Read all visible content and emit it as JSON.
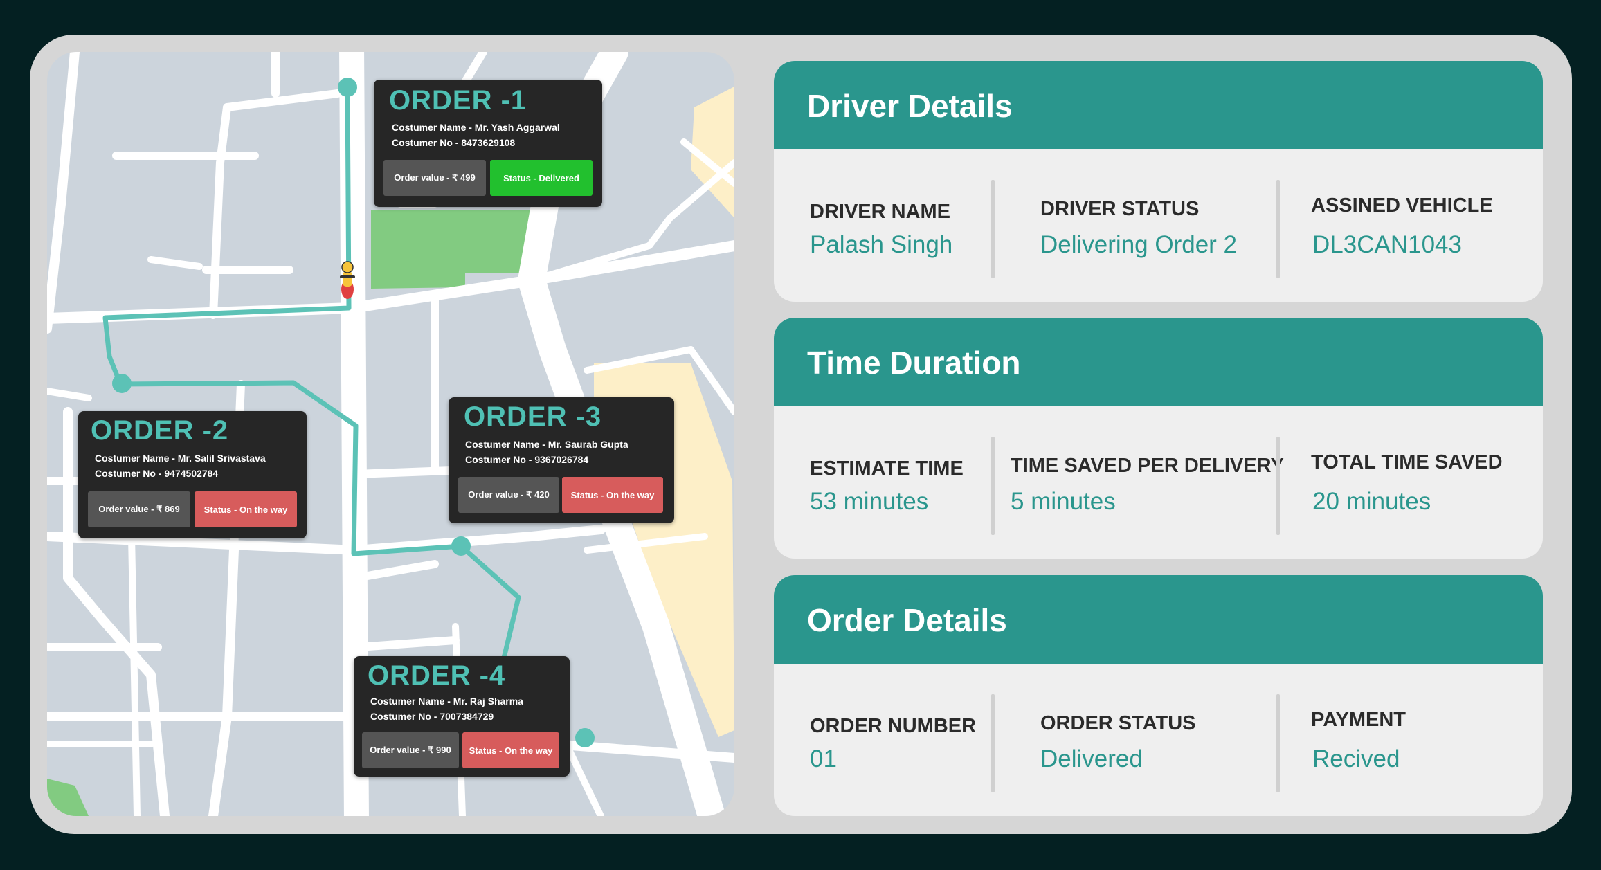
{
  "map": {
    "rider_icon": "delivery-scooter-icon",
    "orders": [
      {
        "title": "ORDER -1",
        "customer_name": "Costumer Name - Mr. Yash Aggarwal",
        "customer_no": "Costumer No - 8473629108",
        "order_value": "Order value - ₹ 499",
        "status": "Status - Delivered",
        "status_color": "#22c02e"
      },
      {
        "title": "ORDER -2",
        "customer_name": "Costumer Name - Mr. Salil Srivastava",
        "customer_no": "Costumer No - 9474502784",
        "order_value": "Order value - ₹ 869",
        "status": "Status - On the way",
        "status_color": "#d75c5c"
      },
      {
        "title": "ORDER -3",
        "customer_name": "Costumer Name - Mr. Saurab Gupta",
        "customer_no": "Costumer No - 9367026784",
        "order_value": "Order value - ₹ 420",
        "status": "Status - On the way",
        "status_color": "#d75c5c"
      },
      {
        "title": "ORDER -4",
        "customer_name": "Costumer Name - Mr. Raj Sharma",
        "customer_no": "Costumer No - 7007384729",
        "order_value": "Order value - ₹ 990",
        "status": "Status - On the way",
        "status_color": "#d75c5c"
      }
    ]
  },
  "driver_details": {
    "title": "Driver Details",
    "fields": [
      {
        "label": "DRIVER NAME",
        "value": "Palash Singh"
      },
      {
        "label": "DRIVER STATUS",
        "value": "Delivering Order 2"
      },
      {
        "label": "ASSINED VEHICLE",
        "value": "DL3CAN1043"
      }
    ]
  },
  "time_duration": {
    "title": "Time Duration",
    "fields": [
      {
        "label": "ESTIMATE TIME",
        "value": "53 minutes"
      },
      {
        "label": "TIME SAVED PER DELIVERY",
        "value": "5 minutes"
      },
      {
        "label": "TOTAL TIME SAVED",
        "value": "20 minutes"
      }
    ]
  },
  "order_details": {
    "title": "Order Details",
    "fields": [
      {
        "label": "ORDER NUMBER",
        "value": "01"
      },
      {
        "label": "ORDER STATUS",
        "value": "Delivered"
      },
      {
        "label": "PAYMENT",
        "value": "Recived"
      }
    ]
  },
  "colors": {
    "background": "#042022",
    "accent": "#2a968d",
    "route": "#5cc2b6",
    "popup": "#262626",
    "delivered": "#22c02e",
    "on_the_way": "#d75c5c"
  }
}
